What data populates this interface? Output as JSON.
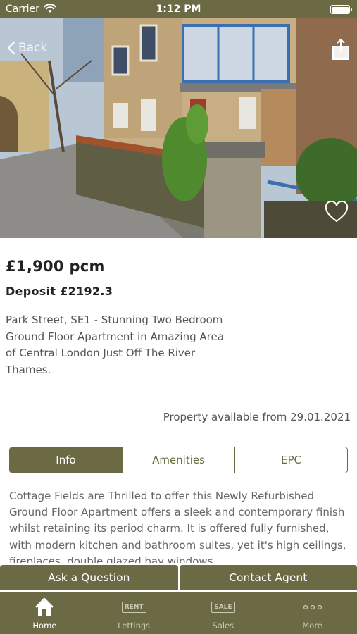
{
  "status_bar": {
    "carrier": "Carrier",
    "time": "1:12 PM"
  },
  "hero": {
    "back_label": "Back"
  },
  "property": {
    "price": "£1,900 pcm",
    "deposit": "Deposit £2192.3",
    "title": "Park Street, SE1 - Stunning Two Bedroom Ground Floor Apartment in Amazing Area of Central London Just Off The River Thames.",
    "availability": "Property available from 29.01.2021"
  },
  "tabs": [
    {
      "label": "Info",
      "active": true
    },
    {
      "label": "Amenities",
      "active": false
    },
    {
      "label": "EPC",
      "active": false
    }
  ],
  "description": "Cottage Fields are Thrilled to offer this Newly Refurbished Ground Floor Apartment offers a sleek and contemporary finish whilst retaining its period charm. It is offered fully furnished, with modern kitchen and bathroom suites, yet it's high ceilings, fireplaces, double glazed bay windows",
  "actions": {
    "ask_question": "Ask a Question",
    "contact_agent": "Contact Agent"
  },
  "tab_bar": [
    {
      "label": "Home",
      "icon": "home-icon",
      "active": true
    },
    {
      "label": "Lettings",
      "icon": "rent-sign-icon",
      "badge": "RENT",
      "active": false
    },
    {
      "label": "Sales",
      "icon": "sale-sign-icon",
      "badge": "SALE",
      "active": false
    },
    {
      "label": "More",
      "icon": "more-dots-icon",
      "active": false
    }
  ],
  "colors": {
    "brand": "#6b6a45",
    "text": "#2b2b2b",
    "muted": "#555555"
  }
}
